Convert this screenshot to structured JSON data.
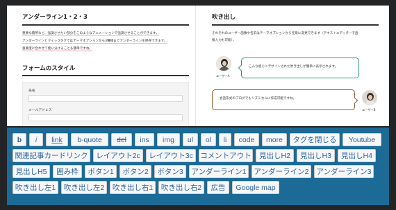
{
  "left_panel": {
    "underline_title": "アンダーライン1・2・3",
    "underline_lines": [
      "重要な箇所など、強調させたい部分をこのようなアニメーションで強調させることができます。",
      "アンダーラインとクイックタグではテーマオプションから3種類までアンダーラインを保存できます。",
      "重要度に合わせて使い分けることも簡単ですね。"
    ],
    "form_title": "フォームのスタイル",
    "form_fields": [
      "氏名",
      "メールアドレス"
    ]
  },
  "right_panel": {
    "balloon_title": "吹き出し",
    "balloon_desc_1": "それぞれのユーザー画像や名前はテーマオプションから任意に変更できます（テキストエディターで直",
    "balloon_desc_2": "接入力も可能）。",
    "balloon_a_text": "こんな感じにデザインされた吹き出しが簡単に表示されます。",
    "balloon_a_name": "ユーザーA",
    "balloon_b_text": "会話形式のブログでもリズミカルに作成可能ですね。",
    "balloon_b_name": "ユーザーB"
  },
  "toolbar": {
    "rows": [
      [
        "b",
        "i",
        "link",
        "b-quote",
        "del",
        "ins",
        "img",
        "ul",
        "ol",
        "li",
        "code",
        "more",
        "タグを閉じる",
        "Youtube"
      ],
      [
        "関連記事カードリンク",
        "レイアウト2c",
        "レイアウト3c",
        "コメントアウト",
        "見出しH2",
        "見出しH3",
        "見出しH4"
      ],
      [
        "見出しH5",
        "囲み枠",
        "ボタン1",
        "ボタン2",
        "ボタン3",
        "アンダーライン1",
        "アンダーライン2",
        "アンダーライン3"
      ],
      [
        "吹き出し左1",
        "吹き出し左2",
        "吹き出し右1",
        "吹き出し右2",
        "広告",
        "Google map"
      ]
    ]
  }
}
